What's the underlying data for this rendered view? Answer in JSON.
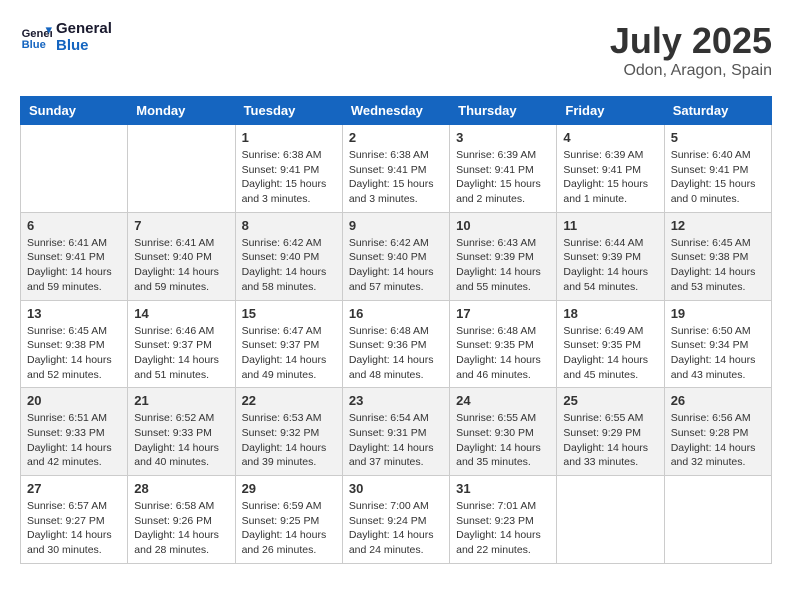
{
  "header": {
    "logo_line1": "General",
    "logo_line2": "Blue",
    "month_title": "July 2025",
    "location": "Odon, Aragon, Spain"
  },
  "weekdays": [
    "Sunday",
    "Monday",
    "Tuesday",
    "Wednesday",
    "Thursday",
    "Friday",
    "Saturday"
  ],
  "weeks": [
    [
      {
        "day": "",
        "sunrise": "",
        "sunset": "",
        "daylight": ""
      },
      {
        "day": "",
        "sunrise": "",
        "sunset": "",
        "daylight": ""
      },
      {
        "day": "1",
        "sunrise": "Sunrise: 6:38 AM",
        "sunset": "Sunset: 9:41 PM",
        "daylight": "Daylight: 15 hours and 3 minutes."
      },
      {
        "day": "2",
        "sunrise": "Sunrise: 6:38 AM",
        "sunset": "Sunset: 9:41 PM",
        "daylight": "Daylight: 15 hours and 3 minutes."
      },
      {
        "day": "3",
        "sunrise": "Sunrise: 6:39 AM",
        "sunset": "Sunset: 9:41 PM",
        "daylight": "Daylight: 15 hours and 2 minutes."
      },
      {
        "day": "4",
        "sunrise": "Sunrise: 6:39 AM",
        "sunset": "Sunset: 9:41 PM",
        "daylight": "Daylight: 15 hours and 1 minute."
      },
      {
        "day": "5",
        "sunrise": "Sunrise: 6:40 AM",
        "sunset": "Sunset: 9:41 PM",
        "daylight": "Daylight: 15 hours and 0 minutes."
      }
    ],
    [
      {
        "day": "6",
        "sunrise": "Sunrise: 6:41 AM",
        "sunset": "Sunset: 9:41 PM",
        "daylight": "Daylight: 14 hours and 59 minutes."
      },
      {
        "day": "7",
        "sunrise": "Sunrise: 6:41 AM",
        "sunset": "Sunset: 9:40 PM",
        "daylight": "Daylight: 14 hours and 59 minutes."
      },
      {
        "day": "8",
        "sunrise": "Sunrise: 6:42 AM",
        "sunset": "Sunset: 9:40 PM",
        "daylight": "Daylight: 14 hours and 58 minutes."
      },
      {
        "day": "9",
        "sunrise": "Sunrise: 6:42 AM",
        "sunset": "Sunset: 9:40 PM",
        "daylight": "Daylight: 14 hours and 57 minutes."
      },
      {
        "day": "10",
        "sunrise": "Sunrise: 6:43 AM",
        "sunset": "Sunset: 9:39 PM",
        "daylight": "Daylight: 14 hours and 55 minutes."
      },
      {
        "day": "11",
        "sunrise": "Sunrise: 6:44 AM",
        "sunset": "Sunset: 9:39 PM",
        "daylight": "Daylight: 14 hours and 54 minutes."
      },
      {
        "day": "12",
        "sunrise": "Sunrise: 6:45 AM",
        "sunset": "Sunset: 9:38 PM",
        "daylight": "Daylight: 14 hours and 53 minutes."
      }
    ],
    [
      {
        "day": "13",
        "sunrise": "Sunrise: 6:45 AM",
        "sunset": "Sunset: 9:38 PM",
        "daylight": "Daylight: 14 hours and 52 minutes."
      },
      {
        "day": "14",
        "sunrise": "Sunrise: 6:46 AM",
        "sunset": "Sunset: 9:37 PM",
        "daylight": "Daylight: 14 hours and 51 minutes."
      },
      {
        "day": "15",
        "sunrise": "Sunrise: 6:47 AM",
        "sunset": "Sunset: 9:37 PM",
        "daylight": "Daylight: 14 hours and 49 minutes."
      },
      {
        "day": "16",
        "sunrise": "Sunrise: 6:48 AM",
        "sunset": "Sunset: 9:36 PM",
        "daylight": "Daylight: 14 hours and 48 minutes."
      },
      {
        "day": "17",
        "sunrise": "Sunrise: 6:48 AM",
        "sunset": "Sunset: 9:35 PM",
        "daylight": "Daylight: 14 hours and 46 minutes."
      },
      {
        "day": "18",
        "sunrise": "Sunrise: 6:49 AM",
        "sunset": "Sunset: 9:35 PM",
        "daylight": "Daylight: 14 hours and 45 minutes."
      },
      {
        "day": "19",
        "sunrise": "Sunrise: 6:50 AM",
        "sunset": "Sunset: 9:34 PM",
        "daylight": "Daylight: 14 hours and 43 minutes."
      }
    ],
    [
      {
        "day": "20",
        "sunrise": "Sunrise: 6:51 AM",
        "sunset": "Sunset: 9:33 PM",
        "daylight": "Daylight: 14 hours and 42 minutes."
      },
      {
        "day": "21",
        "sunrise": "Sunrise: 6:52 AM",
        "sunset": "Sunset: 9:33 PM",
        "daylight": "Daylight: 14 hours and 40 minutes."
      },
      {
        "day": "22",
        "sunrise": "Sunrise: 6:53 AM",
        "sunset": "Sunset: 9:32 PM",
        "daylight": "Daylight: 14 hours and 39 minutes."
      },
      {
        "day": "23",
        "sunrise": "Sunrise: 6:54 AM",
        "sunset": "Sunset: 9:31 PM",
        "daylight": "Daylight: 14 hours and 37 minutes."
      },
      {
        "day": "24",
        "sunrise": "Sunrise: 6:55 AM",
        "sunset": "Sunset: 9:30 PM",
        "daylight": "Daylight: 14 hours and 35 minutes."
      },
      {
        "day": "25",
        "sunrise": "Sunrise: 6:55 AM",
        "sunset": "Sunset: 9:29 PM",
        "daylight": "Daylight: 14 hours and 33 minutes."
      },
      {
        "day": "26",
        "sunrise": "Sunrise: 6:56 AM",
        "sunset": "Sunset: 9:28 PM",
        "daylight": "Daylight: 14 hours and 32 minutes."
      }
    ],
    [
      {
        "day": "27",
        "sunrise": "Sunrise: 6:57 AM",
        "sunset": "Sunset: 9:27 PM",
        "daylight": "Daylight: 14 hours and 30 minutes."
      },
      {
        "day": "28",
        "sunrise": "Sunrise: 6:58 AM",
        "sunset": "Sunset: 9:26 PM",
        "daylight": "Daylight: 14 hours and 28 minutes."
      },
      {
        "day": "29",
        "sunrise": "Sunrise: 6:59 AM",
        "sunset": "Sunset: 9:25 PM",
        "daylight": "Daylight: 14 hours and 26 minutes."
      },
      {
        "day": "30",
        "sunrise": "Sunrise: 7:00 AM",
        "sunset": "Sunset: 9:24 PM",
        "daylight": "Daylight: 14 hours and 24 minutes."
      },
      {
        "day": "31",
        "sunrise": "Sunrise: 7:01 AM",
        "sunset": "Sunset: 9:23 PM",
        "daylight": "Daylight: 14 hours and 22 minutes."
      },
      {
        "day": "",
        "sunrise": "",
        "sunset": "",
        "daylight": ""
      },
      {
        "day": "",
        "sunrise": "",
        "sunset": "",
        "daylight": ""
      }
    ]
  ]
}
